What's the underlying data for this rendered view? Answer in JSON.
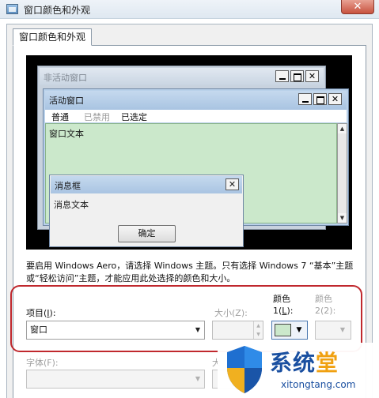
{
  "window": {
    "title": "窗口颜色和外观",
    "close_label": "✕"
  },
  "tab": {
    "label": "窗口颜色和外观"
  },
  "preview": {
    "inactive_title": "非活动窗口",
    "active_title": "活动窗口",
    "menu": {
      "normal": "普通",
      "disabled": "已禁用",
      "selected": "已选定"
    },
    "window_text": "窗口文本",
    "msgbox_title": "消息框",
    "msgbox_text": "消息文本",
    "ok_label": "确定",
    "content_color": "#cbe8cb"
  },
  "description": "要启用 Windows Aero，请选择 Windows 主题。只有选择 Windows 7 “基本”主题或“轻松访问”主题，才能应用此处选择的颜色和大小。",
  "item": {
    "label_prefix": "项目(",
    "label_key": "I",
    "label_suffix": "):",
    "value": "窗口"
  },
  "size": {
    "label": "大小(Z):"
  },
  "color1": {
    "label_top": "颜色",
    "label_prefix": "1(",
    "label_key": "L",
    "label_suffix": "):"
  },
  "color2": {
    "label_top": "颜色",
    "label_bottom": "2(2):"
  },
  "font": {
    "label": "字体(F):"
  },
  "font_size": {
    "label": "大"
  },
  "watermark": {
    "brand_main": "系统",
    "brand_accent": "堂",
    "url": "xitongtang.com"
  }
}
